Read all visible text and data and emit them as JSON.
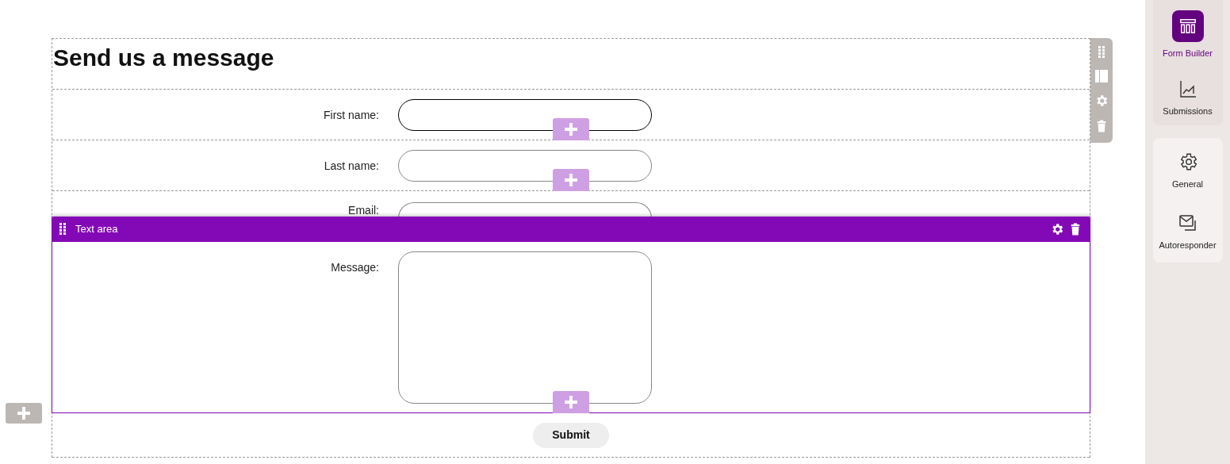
{
  "form": {
    "title": "Send us a message",
    "fields": [
      {
        "label": "First name:",
        "focused": true
      },
      {
        "label": "Last name:",
        "focused": false
      },
      {
        "label": "Email:",
        "focused": false
      }
    ],
    "selected_block": {
      "header": "Text area",
      "label": "Message:"
    },
    "submit": "Submit"
  },
  "sidebar": {
    "groups": [
      [
        {
          "label": "Form Builder",
          "selected": true
        },
        {
          "label": "Submissions",
          "selected": false
        }
      ],
      [
        {
          "label": "General",
          "selected": false
        },
        {
          "label": "Autoresponder",
          "selected": false
        }
      ]
    ]
  }
}
